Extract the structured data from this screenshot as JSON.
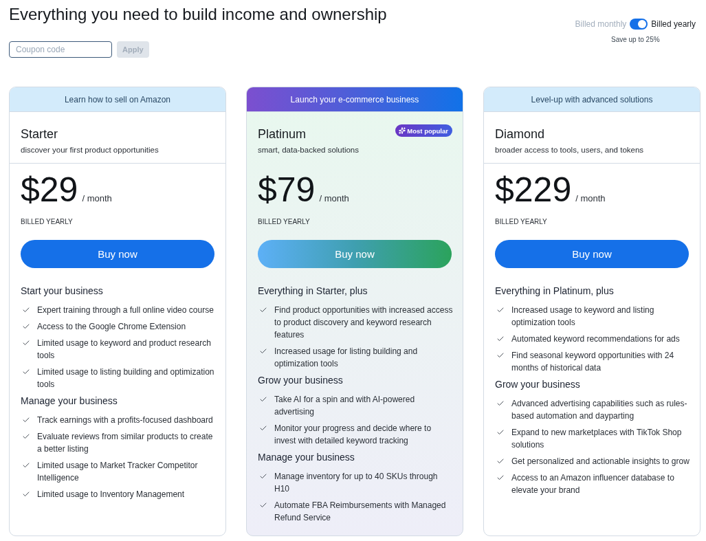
{
  "title": "Everything you need to build income and ownership",
  "coupon": {
    "placeholder": "Coupon code",
    "apply": "Apply",
    "apply_disabled": true
  },
  "billing": {
    "monthly_label": "Billed monthly",
    "yearly_label": "Billed yearly",
    "yearly": true,
    "note": "Save up to 25%"
  },
  "plans": [
    {
      "tagline": "Learn how to sell on Amazon",
      "featured": false,
      "name": "Starter",
      "description": "discover your first product opportunities",
      "price": "$29",
      "period": "/ month",
      "billing_note": "BILLED YEARLY",
      "button": "Buy now",
      "sections": [
        {
          "heading": "Start your business",
          "features": [
            "Expert training through a full online video course",
            "Access to the Google Chrome Extension",
            "Limited usage to keyword and product research tools",
            "Limited usage to listing building and optimization tools"
          ]
        },
        {
          "heading": "Manage your business",
          "features": [
            "Track earnings with a profits-focused dashboard",
            "Evaluate reviews from similar products to create a better listing",
            "Limited usage to Market Tracker Competitor Intelligence",
            "Limited usage to Inventory Management"
          ]
        }
      ]
    },
    {
      "tagline": "Launch your e-commerce business",
      "featured": true,
      "badge": "Most popular",
      "name": "Platinum",
      "description": "smart, data-backed solutions",
      "price": "$79",
      "period": "/ month",
      "billing_note": "BILLED YEARLY",
      "button": "Buy now",
      "sections": [
        {
          "heading": "Everything in Starter, plus",
          "features": [
            "Find product opportunities with increased access to product discovery and keyword research features",
            "Increased usage for listing building and optimization tools"
          ]
        },
        {
          "heading": "Grow your business",
          "features": [
            "Take AI for a spin and with AI-powered advertising",
            "Monitor your progress and decide where to invest with detailed keyword tracking"
          ]
        },
        {
          "heading": "Manage your business",
          "features": [
            "Manage inventory for up to 40 SKUs through H10",
            "Automate FBA Reimbursements with Managed Refund Service"
          ]
        }
      ]
    },
    {
      "tagline": "Level-up with advanced solutions",
      "featured": false,
      "name": "Diamond",
      "description": "broader access to tools, users, and tokens",
      "price": "$229",
      "period": "/ month",
      "billing_note": "BILLED YEARLY",
      "button": "Buy now",
      "sections": [
        {
          "heading": "Everything in Platinum, plus",
          "features": [
            "Increased usage to keyword and listing optimization tools",
            "Automated keyword recommendations for ads",
            "Find seasonal keyword opportunities with 24 months of historical data"
          ]
        },
        {
          "heading": "Grow your business",
          "features": [
            "Advanced advertising capabilities such as rules-based automation and dayparting",
            "Expand to new marketplaces with TikTok Shop solutions",
            "Get personalized and actionable insights to grow",
            "Access to an Amazon influencer database to elevate your brand"
          ]
        }
      ]
    }
  ]
}
